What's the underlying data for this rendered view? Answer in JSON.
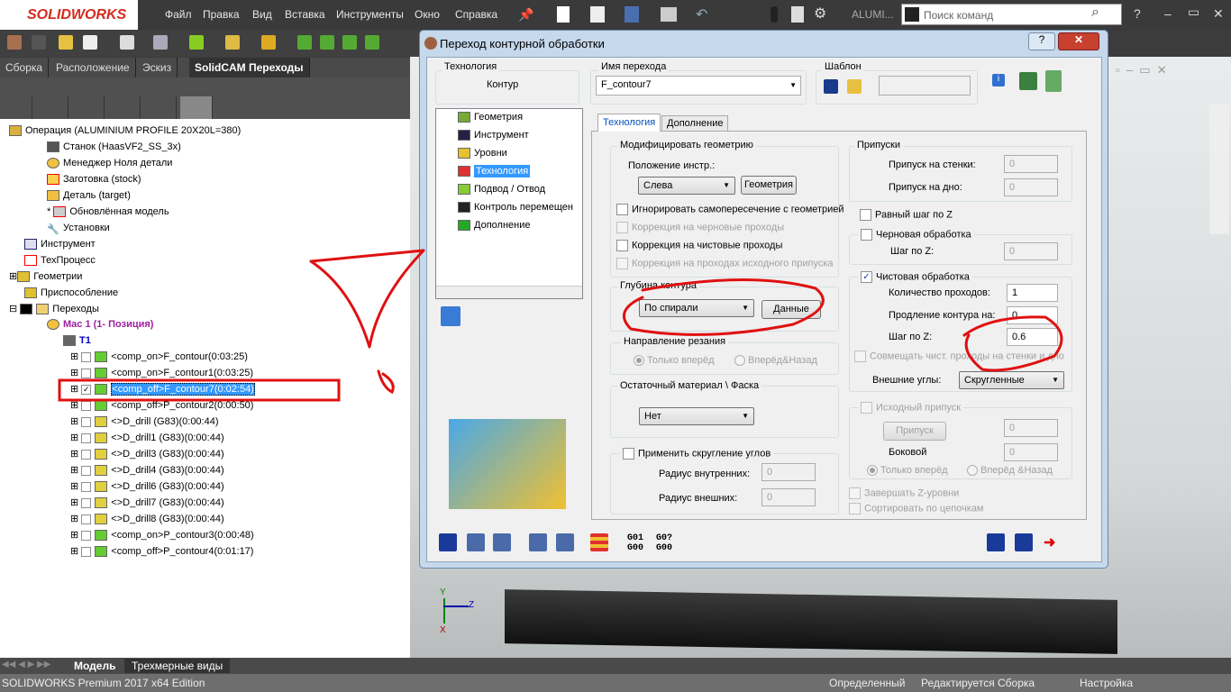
{
  "app": {
    "logo": "SOLIDWORKS",
    "menu": [
      "Файл",
      "Правка",
      "Вид",
      "Вставка",
      "Инструменты",
      "Окно",
      "Справка"
    ],
    "doc_title": "ALUMI...",
    "search_placeholder": "Поиск команд",
    "window_controls": [
      "?",
      "–",
      "▭",
      "✕"
    ]
  },
  "feature_tabs": [
    "Сборка",
    "Расположение",
    "Эскиз",
    "SolidCAM Переходы"
  ],
  "tree": {
    "root": "Операция (ALUMINIUM PROFILE 20X20L=380)",
    "children": [
      "Станок (HaasVF2_SS_3x)",
      "Менеджер Ноля детали",
      "Заготовка (stock)",
      "Деталь (target)",
      "Обновлённая модель",
      "Установки"
    ],
    "top": [
      "Инструмент",
      "ТехПроцесс",
      "Геометрии",
      "Приспособление",
      "Переходы"
    ],
    "mac": "Mac 1 (1- Позиция)",
    "tool": "T1",
    "ops": [
      {
        "label": "<comp_on>F_contour(0:03:25)",
        "checked": false,
        "selected": false
      },
      {
        "label": "<comp_on>F_contour1(0:03:25)",
        "checked": false,
        "selected": false
      },
      {
        "label": "<comp_off>F_contour7(0:02:54)",
        "checked": true,
        "selected": true
      },
      {
        "label": "<comp_off>P_contour2(0:00:50)",
        "checked": false,
        "selected": false
      },
      {
        "label": "<>D_drill (G83)(0:00:44)",
        "checked": false,
        "selected": false
      },
      {
        "label": "<>D_drill1 (G83)(0:00:44)",
        "checked": false,
        "selected": false
      },
      {
        "label": "<>D_drill3 (G83)(0:00:44)",
        "checked": false,
        "selected": false
      },
      {
        "label": "<>D_drill4 (G83)(0:00:44)",
        "checked": false,
        "selected": false
      },
      {
        "label": "<>D_drill6 (G83)(0:00:44)",
        "checked": false,
        "selected": false
      },
      {
        "label": "<>D_drill7 (G83)(0:00:44)",
        "checked": false,
        "selected": false
      },
      {
        "label": "<>D_drill8 (G83)(0:00:44)",
        "checked": false,
        "selected": false
      },
      {
        "label": "<comp_on>P_contour3(0:00:48)",
        "checked": false,
        "selected": false
      },
      {
        "label": "<comp_off>P_contour4(0:01:17)",
        "checked": false,
        "selected": false
      }
    ]
  },
  "dialog": {
    "title": "Переход контурной обработки",
    "tech_label": "Технология",
    "tech_value": "Контур",
    "name_label": "Имя перехода",
    "name_value": "F_contour7",
    "template_label": "Шаблон",
    "nav": [
      "Геометрия",
      "Инструмент",
      "Уровни",
      "Технология",
      "Подвод / Отвод",
      "Контроль перемещен",
      "Дополнение"
    ],
    "nav_selected": 3,
    "tabs": [
      "Технология",
      "Дополнение"
    ],
    "modify": {
      "title": "Модифицировать геометрию",
      "pos_label": "Положение инстр.:",
      "pos_value": "Слева",
      "geom_btn": "Геометрия",
      "checks": [
        {
          "label": "Игнорировать самопересечение с геометрией",
          "checked": false,
          "enabled": true
        },
        {
          "label": "Коррекция на черновые проходы",
          "checked": false,
          "enabled": false
        },
        {
          "label": "Коррекция на чистовые проходы",
          "checked": false,
          "enabled": true
        },
        {
          "label": "Коррекция на проходах исходного припуска",
          "checked": false,
          "enabled": false
        }
      ]
    },
    "depth": {
      "title": "Глубина контура",
      "value": "По спирали",
      "btn": "Данные"
    },
    "direction": {
      "title": "Направление резания",
      "opt1": "Только вперёд",
      "opt2": "Вперёд&Назад"
    },
    "rest": {
      "title": "Остаточный материал \\ Фаска",
      "value": "Нет"
    },
    "round": {
      "title": "Применить скругление углов",
      "inner_label": "Радиус внутренних:",
      "inner": "0",
      "outer_label": "Радиус внешних:",
      "outer": "0"
    },
    "allow": {
      "title": "Припуски",
      "wall_label": "Припуск на стенки:",
      "wall": "0",
      "floor_label": "Припуск на дно:",
      "floor": "0"
    },
    "equal_step": "Равный шаг по Z",
    "rough": {
      "title": "Черновая обработка",
      "step_label": "Шаг по Z:",
      "step": "0"
    },
    "finish": {
      "title": "Чистовая обработка",
      "checked": true,
      "passes_label": "Количество проходов:",
      "passes": "1",
      "ext_label": "Продление контура на:",
      "ext": "0",
      "step_label": "Шаг по Z:",
      "step": "0.6",
      "combine": "Совмещать чист. проходы на стенки и дно",
      "corners_label": "Внешние углы:",
      "corners": "Скругленные"
    },
    "source": {
      "title": "Исходный припуск",
      "btn": "Припуск",
      "val1": "0",
      "side_label": "Боковой",
      "side": "0",
      "opt1": "Только вперёд",
      "opt2": "Вперёд &Назад"
    },
    "finish_z": "Завершать Z-уровни",
    "sort_chain": "Сортировать по цепочкам",
    "gcode": [
      "G01",
      "G00",
      "G0",
      "G00"
    ]
  },
  "bottom_tabs": [
    "Модель",
    "Трехмерные виды"
  ],
  "status": {
    "edition": "SOLIDWORKS Premium 2017 x64 Edition",
    "state": "Определенный",
    "editing": "Редактируется Сборка",
    "settings": "Настройка"
  },
  "colors": {
    "annotation": "#e01010",
    "selection": "#3399ff",
    "dark_ui": "#3c3c3c"
  }
}
